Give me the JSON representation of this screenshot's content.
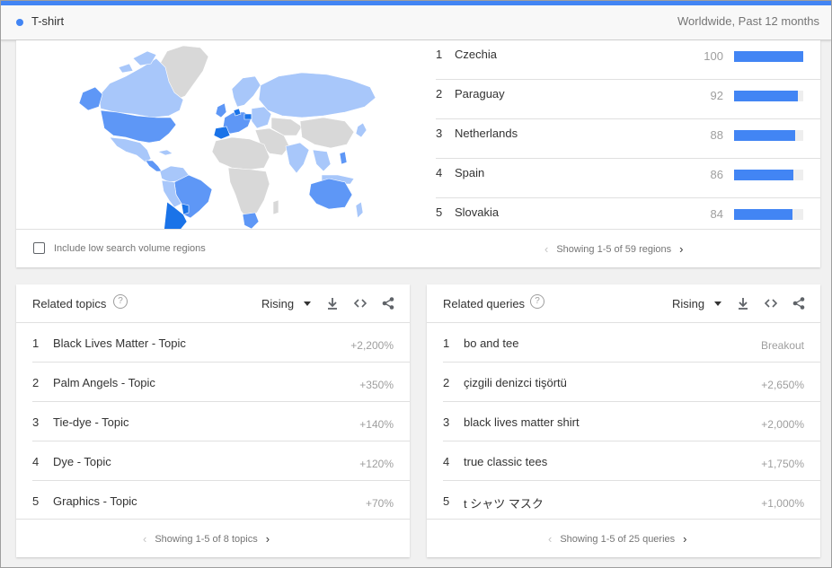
{
  "colors": {
    "accent": "#4285f4",
    "map_high": "#1a73e8",
    "map_mid": "#5e97f6",
    "map_low": "#a8c7fa",
    "map_none": "#d8d8d8"
  },
  "header": {
    "term": "T-shirt",
    "meta": "Worldwide, Past 12 months"
  },
  "regions": {
    "items": [
      {
        "rank": "1",
        "name": "Czechia",
        "score": 100
      },
      {
        "rank": "2",
        "name": "Paraguay",
        "score": 92
      },
      {
        "rank": "3",
        "name": "Netherlands",
        "score": 88
      },
      {
        "rank": "4",
        "name": "Spain",
        "score": 86
      },
      {
        "rank": "5",
        "name": "Slovakia",
        "score": 84
      }
    ],
    "checkbox_label": "Include low search volume regions",
    "pager": "Showing 1-5 of 59 regions"
  },
  "topics": {
    "title": "Related topics",
    "filter": "Rising",
    "items": [
      {
        "rank": "1",
        "name": "Black Lives Matter - Topic",
        "change": "+2,200%"
      },
      {
        "rank": "2",
        "name": "Palm Angels - Topic",
        "change": "+350%"
      },
      {
        "rank": "3",
        "name": "Tie-dye - Topic",
        "change": "+140%"
      },
      {
        "rank": "4",
        "name": "Dye - Topic",
        "change": "+120%"
      },
      {
        "rank": "5",
        "name": "Graphics - Topic",
        "change": "+70%"
      }
    ],
    "pager": "Showing 1-5 of 8 topics"
  },
  "queries": {
    "title": "Related queries",
    "filter": "Rising",
    "items": [
      {
        "rank": "1",
        "name": "bo and tee",
        "change": "Breakout"
      },
      {
        "rank": "2",
        "name": "çizgili denizci tişörtü",
        "change": "+2,650%"
      },
      {
        "rank": "3",
        "name": "black lives matter shirt",
        "change": "+2,000%"
      },
      {
        "rank": "4",
        "name": "true classic tees",
        "change": "+1,750%"
      },
      {
        "rank": "5",
        "name": "t シャツ マスク",
        "change": "+1,000%"
      }
    ],
    "pager": "Showing 1-5 of 25 queries"
  },
  "icons": {
    "help": "help-circle-icon",
    "download": "download-icon",
    "embed": "embed-code-icon",
    "share": "share-icon",
    "prev": "chevron-left-icon",
    "next": "chevron-right-icon"
  }
}
